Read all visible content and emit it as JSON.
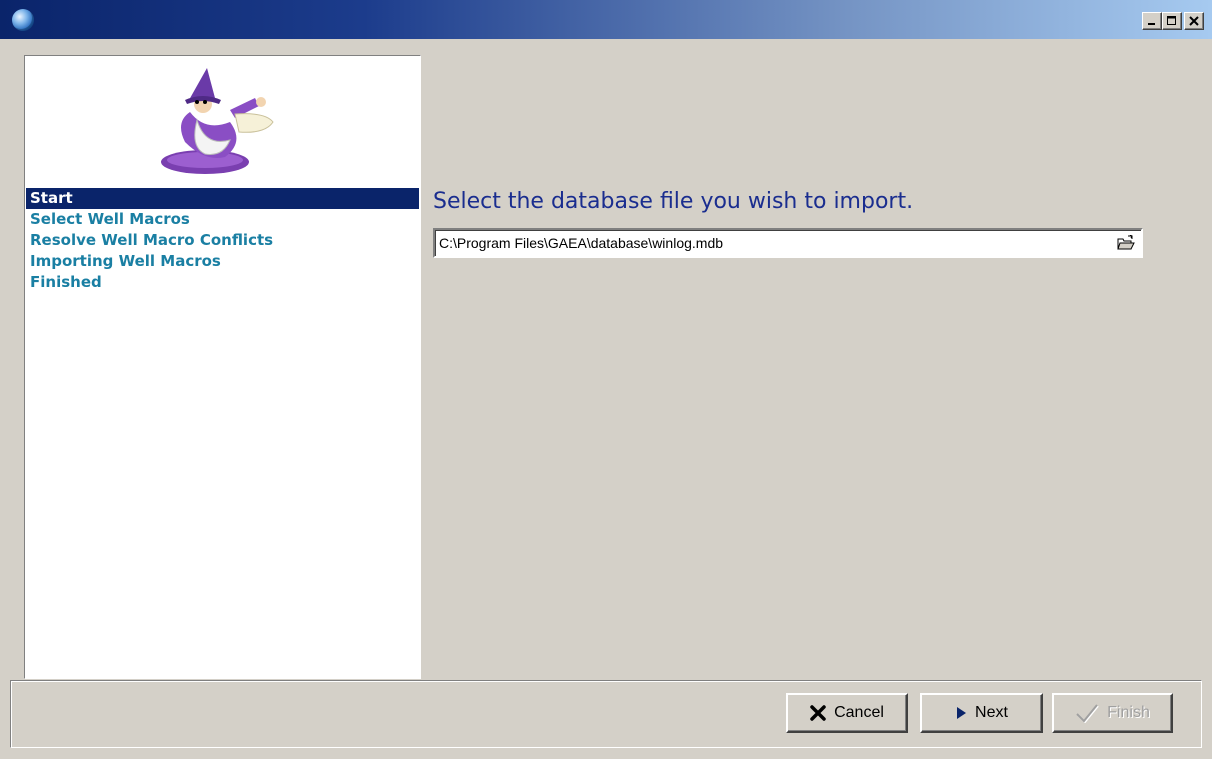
{
  "window": {
    "title": "",
    "controls": [
      "minimize",
      "maximize",
      "close"
    ]
  },
  "sidebar": {
    "illustration": "wizard-mascot",
    "steps": [
      {
        "label": "Start",
        "active": true
      },
      {
        "label": "Select Well Macros",
        "active": false
      },
      {
        "label": "Resolve Well Macro Conflicts",
        "active": false
      },
      {
        "label": "Importing Well Macros",
        "active": false
      },
      {
        "label": "Finished",
        "active": false
      }
    ]
  },
  "main": {
    "prompt": "Select the database file you wish to import.",
    "file_path": "C:\\Program Files\\GAEA\\database\\winlog.mdb",
    "browse_icon": "open-folder-icon"
  },
  "buttons": {
    "cancel": {
      "label": "Cancel",
      "icon": "x-icon",
      "enabled": true
    },
    "next": {
      "label": "Next",
      "icon": "play-arrow-icon",
      "enabled": true
    },
    "finish": {
      "label": "Finish",
      "icon": "checkmark-icon",
      "enabled": false
    }
  },
  "colors": {
    "title_bar_start": "#0a246a",
    "title_bar_end": "#a6caf0",
    "selection": "#0a246a",
    "step_text": "#1a7fa3",
    "prompt_text": "#1a2d8f",
    "face": "#d4d0c8"
  }
}
